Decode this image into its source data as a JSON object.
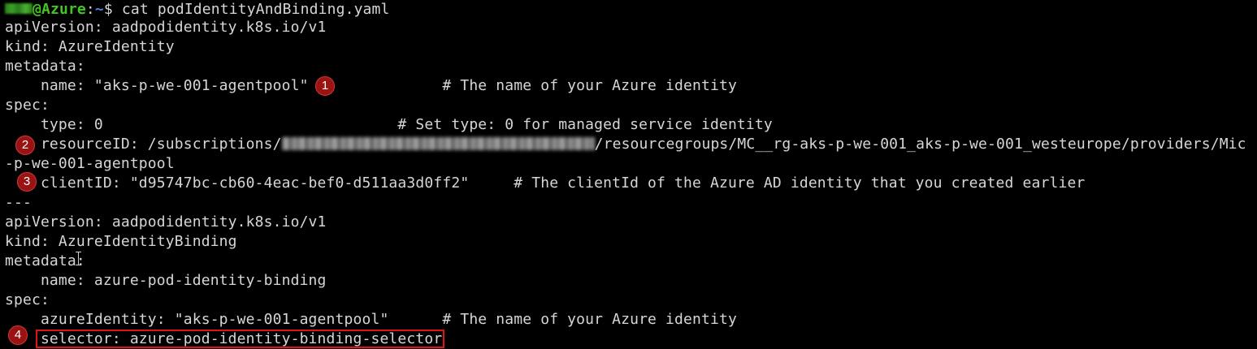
{
  "prompt": {
    "user": "@Azure",
    "separator": ":",
    "path": "~",
    "dollar": "$",
    "command": " cat podIdentityAndBinding.yaml"
  },
  "lines": {
    "l1": "apiVersion: aadpodidentity.k8s.io/v1",
    "l2": "kind: AzureIdentity",
    "l3": "metadata:",
    "l4": "    name: \"aks-p-we-001-agentpool\"               # The name of your Azure identity",
    "l5": "spec:",
    "l6": "    type: 0                                 # Set type: 0 for managed service identity",
    "l7a": "    resourceID: /subscriptions/",
    "l7b": "/resourcegroups/MC__rg-aks-p-we-001_aks-p-we-001_westeurope/providers/Mic",
    "l8": "-p-we-001-agentpool",
    "l9": "    clientID: \"d95747bc-cb60-4eac-bef0-d511aa3d0ff2\"     # The clientId of the Azure AD identity that you created earlier",
    "l10": "---",
    "l11": "apiVersion: aadpodidentity.k8s.io/v1",
    "l12": "kind: AzureIdentityBinding",
    "l13": "metadata:",
    "l14": "    name: azure-pod-identity-binding",
    "l15": "spec:",
    "l16": "    azureIdentity: \"aks-p-we-001-agentpool\"      # The name of your Azure identity",
    "l17": "    selector: azure-pod-identity-binding-selector"
  },
  "badges": {
    "b1": "1",
    "b2": "2",
    "b3": "3",
    "b4": "4"
  },
  "colors": {
    "background": "#000000",
    "text": "#d6d6d6",
    "prompt_user": "#43c623",
    "prompt_path": "#4f7fe4",
    "badge": "#9b1212",
    "highlight_box": "#e01414"
  }
}
